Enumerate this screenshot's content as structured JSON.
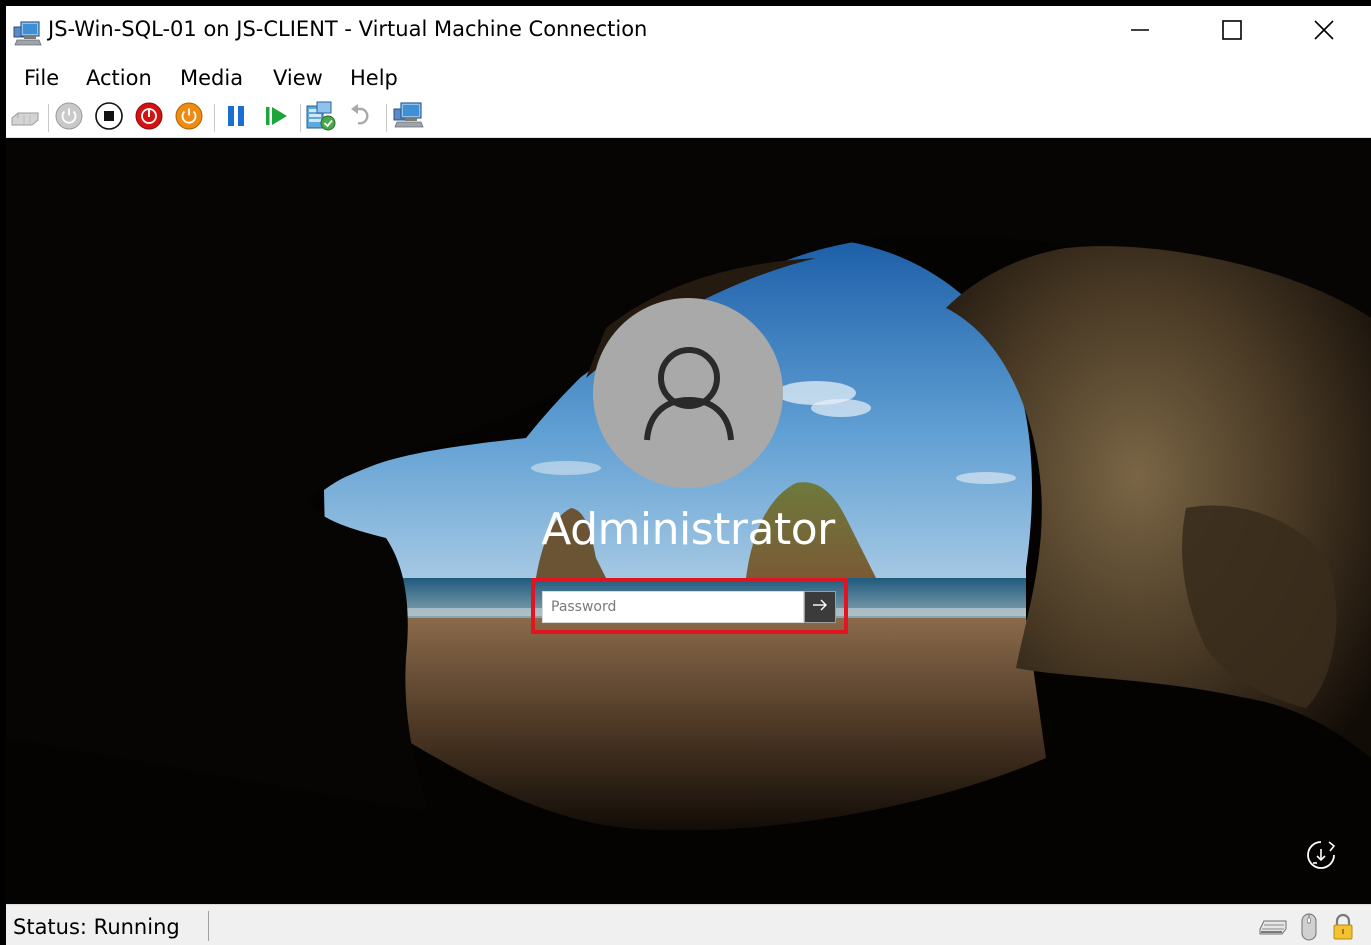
{
  "window": {
    "title": "JS-Win-SQL-01 on JS-CLIENT - Virtual Machine Connection",
    "controls": [
      "minimize-icon",
      "maximize-icon",
      "close-icon"
    ]
  },
  "menu": {
    "items": [
      {
        "label": "File"
      },
      {
        "label": "Action"
      },
      {
        "label": "Media"
      },
      {
        "label": "View"
      },
      {
        "label": "Help"
      }
    ]
  },
  "toolbar": {
    "buttons": [
      {
        "icon": "ctrl-alt-del-icon"
      },
      {
        "icon": "start-icon"
      },
      {
        "icon": "turn-off-icon"
      },
      {
        "icon": "shutdown-icon"
      },
      {
        "icon": "save-icon"
      },
      {
        "icon": "pause-icon"
      },
      {
        "icon": "resume-icon"
      },
      {
        "icon": "checkpoint-icon"
      },
      {
        "icon": "revert-icon"
      },
      {
        "icon": "enhanced-session-icon"
      }
    ]
  },
  "login": {
    "username": "Administrator",
    "password_placeholder": "Password",
    "password_value": "",
    "highlight_color": "#e2141f"
  },
  "status": {
    "text": "Status: Running",
    "icons": [
      "keyboard-icon",
      "mouse-icon",
      "lock-icon"
    ]
  }
}
